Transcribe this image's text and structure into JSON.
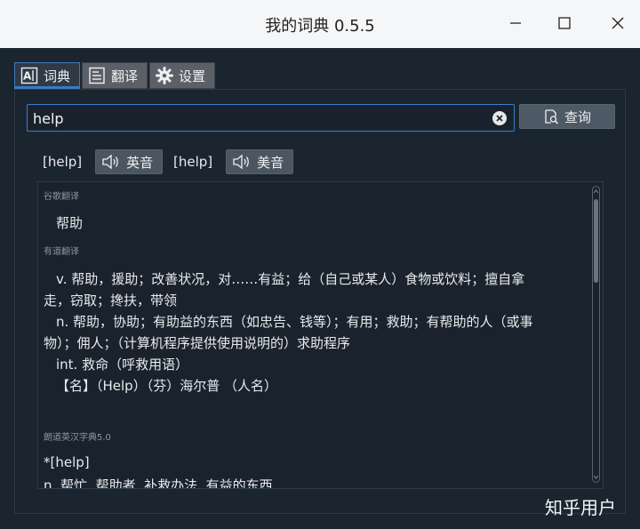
{
  "window": {
    "title": "我的词典 0.5.5"
  },
  "tabs": [
    {
      "label": "词典",
      "icon": "dictionary-icon",
      "active": true
    },
    {
      "label": "翻译",
      "icon": "translate-icon",
      "active": false
    },
    {
      "label": "设置",
      "icon": "gear-icon",
      "active": false
    }
  ],
  "search": {
    "value": "help",
    "button_label": "查询"
  },
  "pronunciation": [
    {
      "phonetic": "[help]",
      "label": "英音"
    },
    {
      "phonetic": "[help]",
      "label": "美音"
    }
  ],
  "results": {
    "google": {
      "source": "谷歌翻译",
      "text": "帮助"
    },
    "youdao": {
      "source": "有道翻译",
      "lines": [
        "v. 帮助，援助；改善状况，对……有益；给（自己或某人）食物或饮料；擅自拿",
        "走，窃取；搀扶，带领",
        "n. 帮助，协助；有助益的东西（如忠告、钱等）；有用；救助；有帮助的人（或事",
        "物）；佣人；（计算机程序提供使用说明的）求助程序",
        "int. 救命（呼救用语）",
        "【名】（Help）（芬）海尔普 （人名）"
      ]
    },
    "langdao": {
      "source": "朗道英汉字典5.0",
      "lines": [
        "*[help]",
        "n. 帮忙, 帮助者, 补救办法, 有益的东西"
      ]
    }
  },
  "watermark": "知乎用户",
  "colors": {
    "accent": "#3e7ac2",
    "background": "#1b2530",
    "titlebar": "#f5f6f7"
  }
}
